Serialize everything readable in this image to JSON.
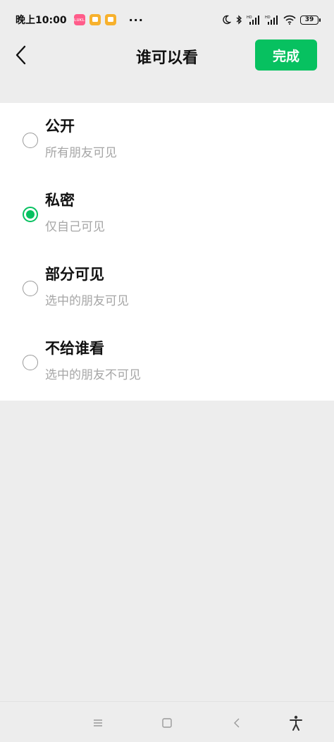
{
  "status_bar": {
    "time": "晚上10:00",
    "badge1_text": "ʟᴜᴋʟ",
    "dots": "···",
    "battery": "39",
    "icons": [
      "moon-icon",
      "bluetooth-icon",
      "signal-hd-icon",
      "signal-hd-icon",
      "wifi-icon",
      "battery-icon"
    ]
  },
  "header": {
    "title": "谁可以看",
    "done_label": "完成",
    "accent_color": "#07c160"
  },
  "options": [
    {
      "title": "公开",
      "subtitle": "所有朋友可见",
      "selected": false
    },
    {
      "title": "私密",
      "subtitle": "仅自己可见",
      "selected": true
    },
    {
      "title": "部分可见",
      "subtitle": "选中的朋友可见",
      "selected": false
    },
    {
      "title": "不给谁看",
      "subtitle": "选中的朋友不可见",
      "selected": false
    }
  ],
  "nav_bar": {
    "icons": [
      "menu-icon",
      "home-icon",
      "back-icon",
      "accessibility-icon"
    ]
  }
}
